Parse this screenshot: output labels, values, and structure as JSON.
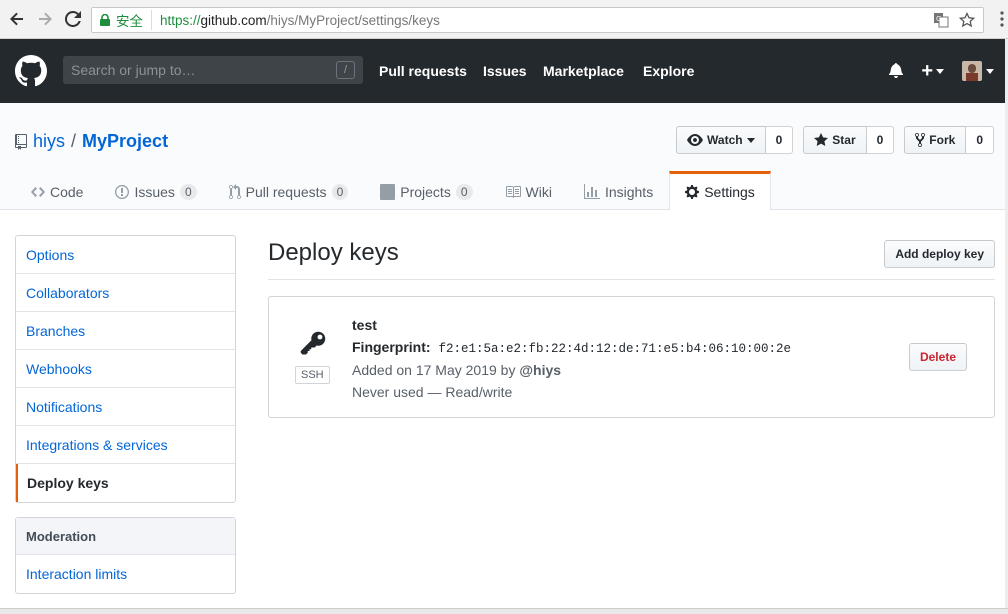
{
  "browser": {
    "secure_label": "安全",
    "url_scheme": "https://",
    "url_host": "github.com",
    "url_path": "/hiys/MyProject/settings/keys"
  },
  "header": {
    "search_placeholder": "Search or jump to…",
    "search_kbd": "/",
    "nav": [
      "Pull requests",
      "Issues",
      "Marketplace",
      "Explore"
    ],
    "plus": "+"
  },
  "repo": {
    "owner": "hiys",
    "separator": "/",
    "name": "MyProject",
    "watch_label": "Watch",
    "watch_count": "0",
    "star_label": "Star",
    "star_count": "0",
    "fork_label": "Fork",
    "fork_count": "0"
  },
  "tabs": [
    {
      "label": "Code"
    },
    {
      "label": "Issues",
      "count": "0"
    },
    {
      "label": "Pull requests",
      "count": "0"
    },
    {
      "label": "Projects",
      "count": "0"
    },
    {
      "label": "Wiki"
    },
    {
      "label": "Insights"
    },
    {
      "label": "Settings"
    }
  ],
  "settings_menu": [
    "Options",
    "Collaborators",
    "Branches",
    "Webhooks",
    "Notifications",
    "Integrations & services",
    "Deploy keys"
  ],
  "moderation_menu": {
    "heading": "Moderation",
    "items": [
      "Interaction limits"
    ]
  },
  "main": {
    "heading": "Deploy keys",
    "add_button": "Add deploy key",
    "key": {
      "title": "test",
      "type_label": "SSH",
      "fingerprint_label": "Fingerprint:",
      "fingerprint": "f2:e1:5a:e2:fb:22:4d:12:de:71:e5:b4:06:10:00:2e",
      "added_prefix": "Added on 17 May 2019 by",
      "added_by": "@hiys",
      "usage": "Never used — Read/write",
      "delete_label": "Delete"
    }
  },
  "colors": {
    "header_bg": "#24292e",
    "link": "#0366d6",
    "accent": "#e36209",
    "danger": "#cb2431"
  }
}
